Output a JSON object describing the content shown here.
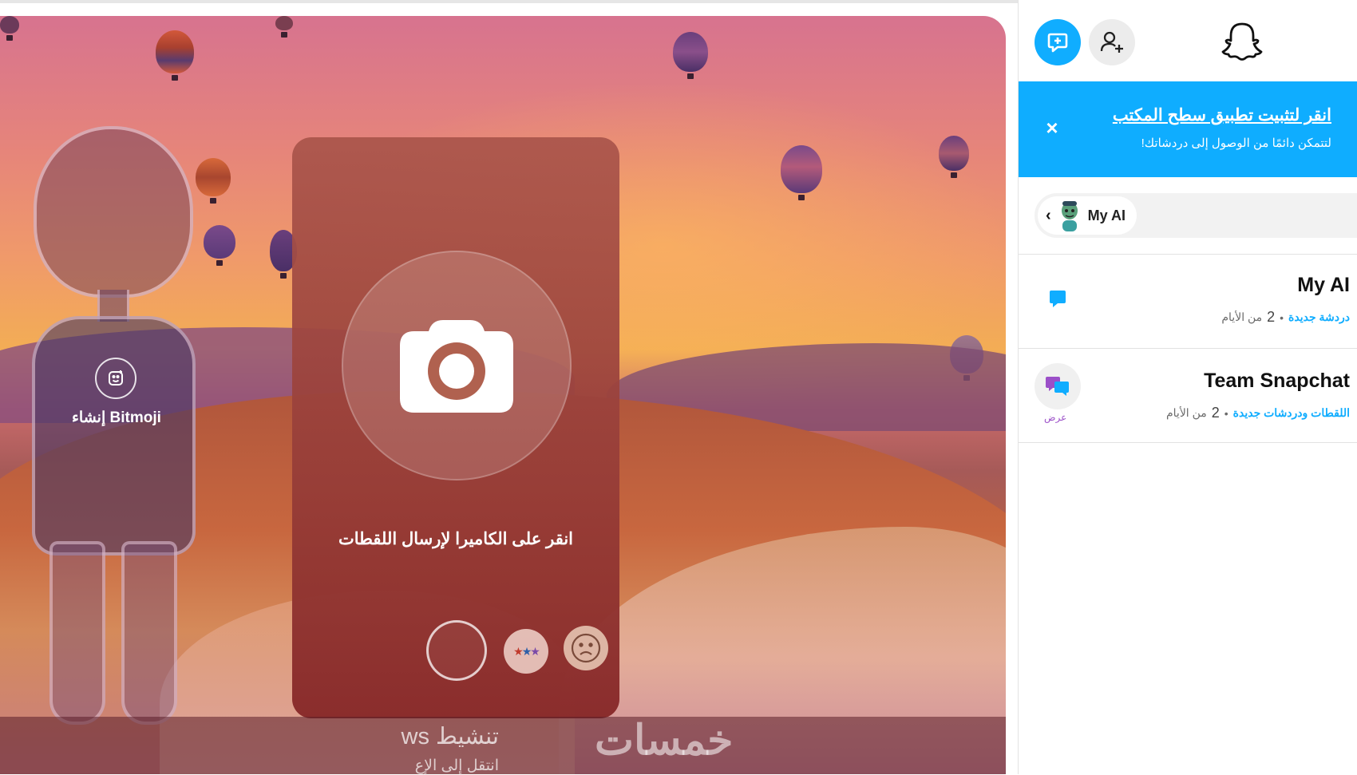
{
  "stage": {
    "bitmoji_label": "إنشاء Bitmoji",
    "camera_prompt": "انقر على الكاميرا لإرسال اللقطات",
    "activate_title": "تنشيط ws",
    "activate_sub": "انتقل إلى الإع",
    "watermark": "خمسات"
  },
  "sidebar": {
    "banner": {
      "title": "انقر لتثبيت تطبيق سطح المكتب",
      "subtitle": "لتتمكن دائمًا من الوصول إلى دردشاتك!",
      "close": "×"
    },
    "filter_chip": {
      "chevron": "‹",
      "label": "My AI"
    },
    "chats": [
      {
        "name": "My AI",
        "status": "دردشة جديدة",
        "separator": "•",
        "age_num": "2",
        "age_text": "من الأيام"
      },
      {
        "name": "Team Snapchat",
        "status": "اللقطات ودردشات جديدة",
        "separator": "•",
        "age_num": "2",
        "age_text": "من الأيام",
        "action": "عرض"
      }
    ]
  },
  "colors": {
    "accent": "#10adff",
    "banner": "#0fadff",
    "view_purple": "#9b4fc8"
  },
  "icons": [
    "new-chat-icon",
    "add-friend-icon",
    "snapchat-ghost-icon",
    "close-icon",
    "camera-icon",
    "bitmoji-icon",
    "chat-bubble-icon",
    "team-snapchat-icon"
  ]
}
